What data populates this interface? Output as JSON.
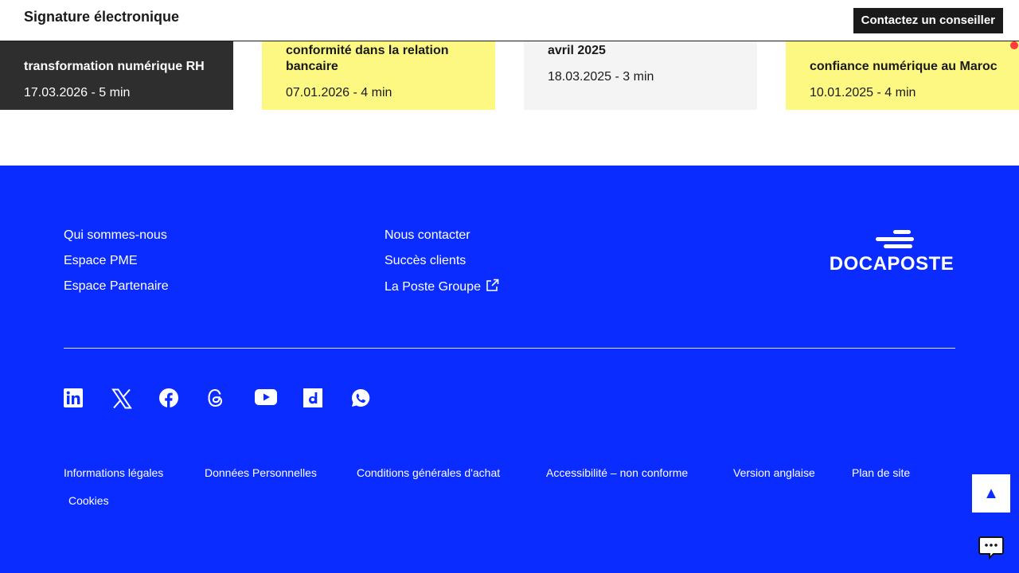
{
  "header": {
    "title": "Signature électronique",
    "cta_label": "Contactez un conseiller"
  },
  "cards": [
    {
      "title": "transformation numérique RH",
      "meta": "17.03.2026 - 5 min",
      "theme": "#2e2e2e"
    },
    {
      "title": "conformité dans la relation bancaire",
      "meta": "07.01.2026 - 4 min",
      "theme": "#fcf882"
    },
    {
      "title": "avril 2025",
      "meta": "18.03.2025 - 3 min",
      "theme": "#f4f4f4"
    },
    {
      "title": "confiance numérique au Maroc",
      "meta": "10.01.2025 - 4 min",
      "theme": "#fcf882"
    }
  ],
  "footer": {
    "bg_color": "#0a2cff",
    "col1": [
      "Qui sommes-nous",
      "Espace PME",
      "Espace Partenaire"
    ],
    "col2": [
      "Nous contacter",
      "Succès clients",
      "La Poste Groupe"
    ],
    "logo_text": "DOCAPOSTE",
    "socials": [
      "linkedin-icon",
      "x-icon",
      "facebook-icon",
      "threads-icon",
      "youtube-icon",
      "dailymotion-icon",
      "whatsapp-icon"
    ],
    "legal": [
      "Informations légales",
      "Données Personnelles",
      "Conditions générales d'achat",
      "Accessibilité – non conforme",
      "Version anglaise",
      "Plan de site",
      "Cookies"
    ]
  },
  "widgets": {
    "back_to_top": "▲"
  }
}
